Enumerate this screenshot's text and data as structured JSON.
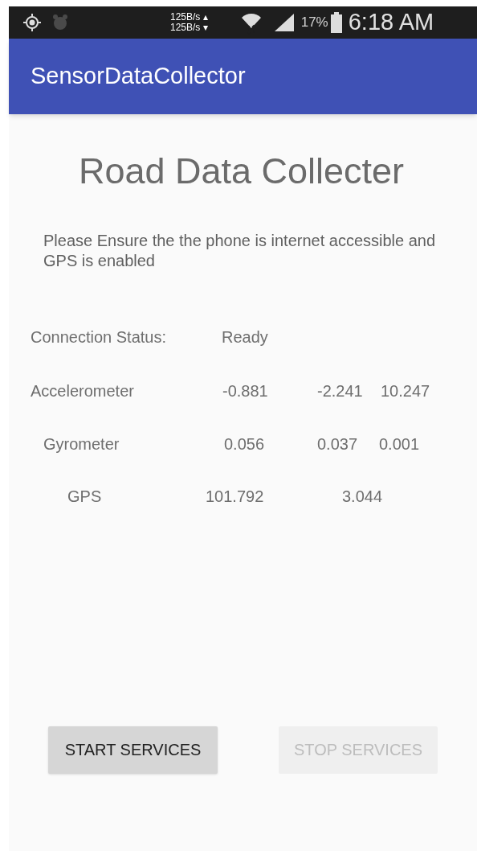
{
  "status_bar": {
    "upload_rate": "125B/s ▴",
    "download_rate": "125B/s ▾",
    "battery": "17%",
    "time": "6:18 AM"
  },
  "app_bar": {
    "title": "SensorDataCollector"
  },
  "heading": "Road Data Collecter",
  "instructions": "Please Ensure the the phone is internet accessible and GPS is enabled",
  "rows": [
    {
      "label": "Connection Status:",
      "values": [
        "Ready"
      ]
    },
    {
      "label": "Accelerometer",
      "values": [
        "-0.881",
        "-2.241",
        "10.247"
      ]
    },
    {
      "label": "Gyrometer",
      "values": [
        "0.056",
        "0.037",
        "0.001"
      ]
    },
    {
      "label": "GPS",
      "values": [
        "101.792",
        "3.044"
      ]
    }
  ],
  "buttons": [
    {
      "label": "START SERVICES",
      "disabled": false
    },
    {
      "label": "STOP SERVICES",
      "disabled": true
    }
  ]
}
